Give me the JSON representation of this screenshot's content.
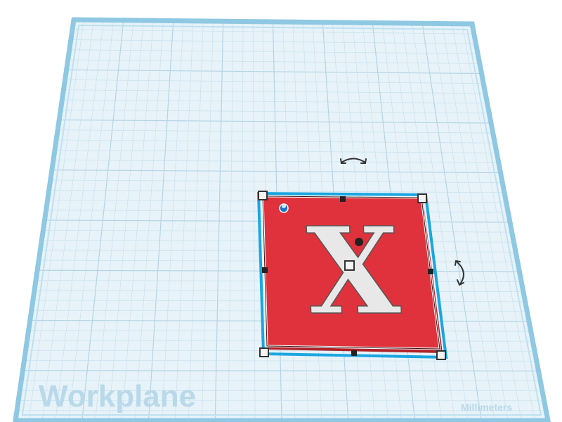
{
  "workplane": {
    "label": "Workplane",
    "units_label": "Millimeters"
  },
  "shape": {
    "letter": "X",
    "color": "#e0323c",
    "letter_color": "#e8e8e8"
  },
  "colors": {
    "grid_background": "#e7f3f9",
    "grid_line": "#c9e0ec",
    "grid_major_line": "#b4d4e4",
    "border": "#8fc8e2",
    "selection_outline": "#1aa6e0"
  },
  "icons": {
    "rotate_top": "rotate-arrow-icon",
    "rotate_right": "rotate-arrow-icon",
    "hole_marker": "hole-icon"
  }
}
